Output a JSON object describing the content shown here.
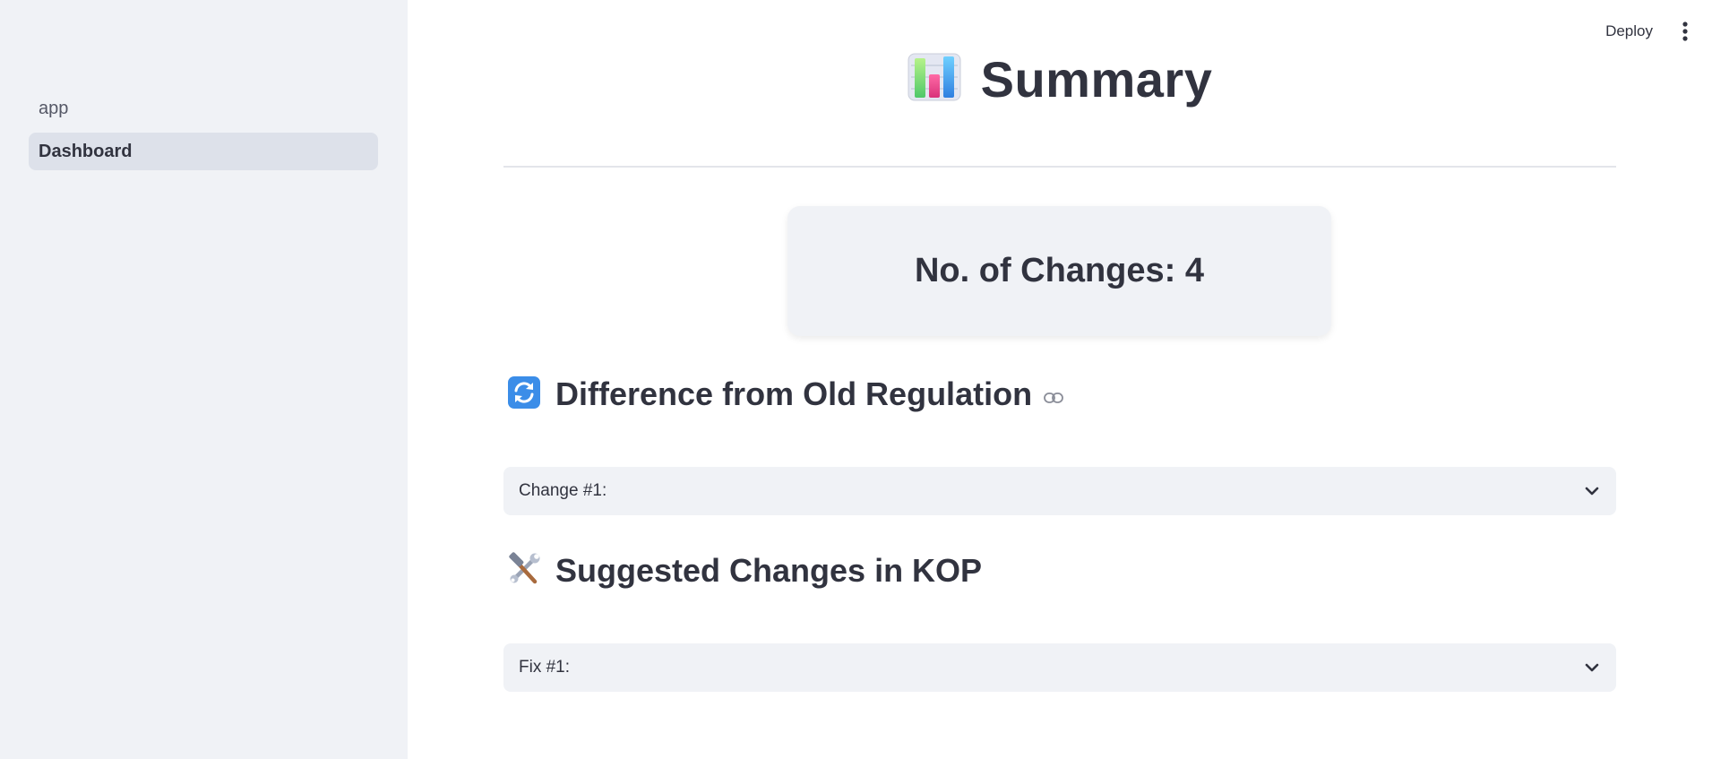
{
  "sidebar": {
    "items": [
      {
        "label": "app",
        "active": false
      },
      {
        "label": "Dashboard",
        "active": true
      }
    ]
  },
  "header": {
    "deploy_label": "Deploy",
    "menu_icon": "kebab-menu-icon"
  },
  "main": {
    "title": "Summary",
    "title_icon": "bar-chart-icon",
    "metric": {
      "text": "No. of Changes: 4"
    },
    "sections": [
      {
        "heading": "Difference from Old Regulation",
        "icon": "counterclockwise-arrows-icon",
        "has_anchor_link": true,
        "expanders": [
          {
            "label": "Change #1:",
            "expanded": false
          }
        ]
      },
      {
        "heading": "Suggested Changes in KOP",
        "icon": "hammer-and-wrench-icon",
        "has_anchor_link": false,
        "expanders": [
          {
            "label": "Fix #1:",
            "expanded": false
          }
        ]
      }
    ]
  },
  "colors": {
    "sidebar_bg": "#f0f2f6",
    "active_nav_bg": "#dde1ea",
    "text": "#31333f",
    "card_bg": "#f0f2f6",
    "divider": "#e3e5ea"
  }
}
